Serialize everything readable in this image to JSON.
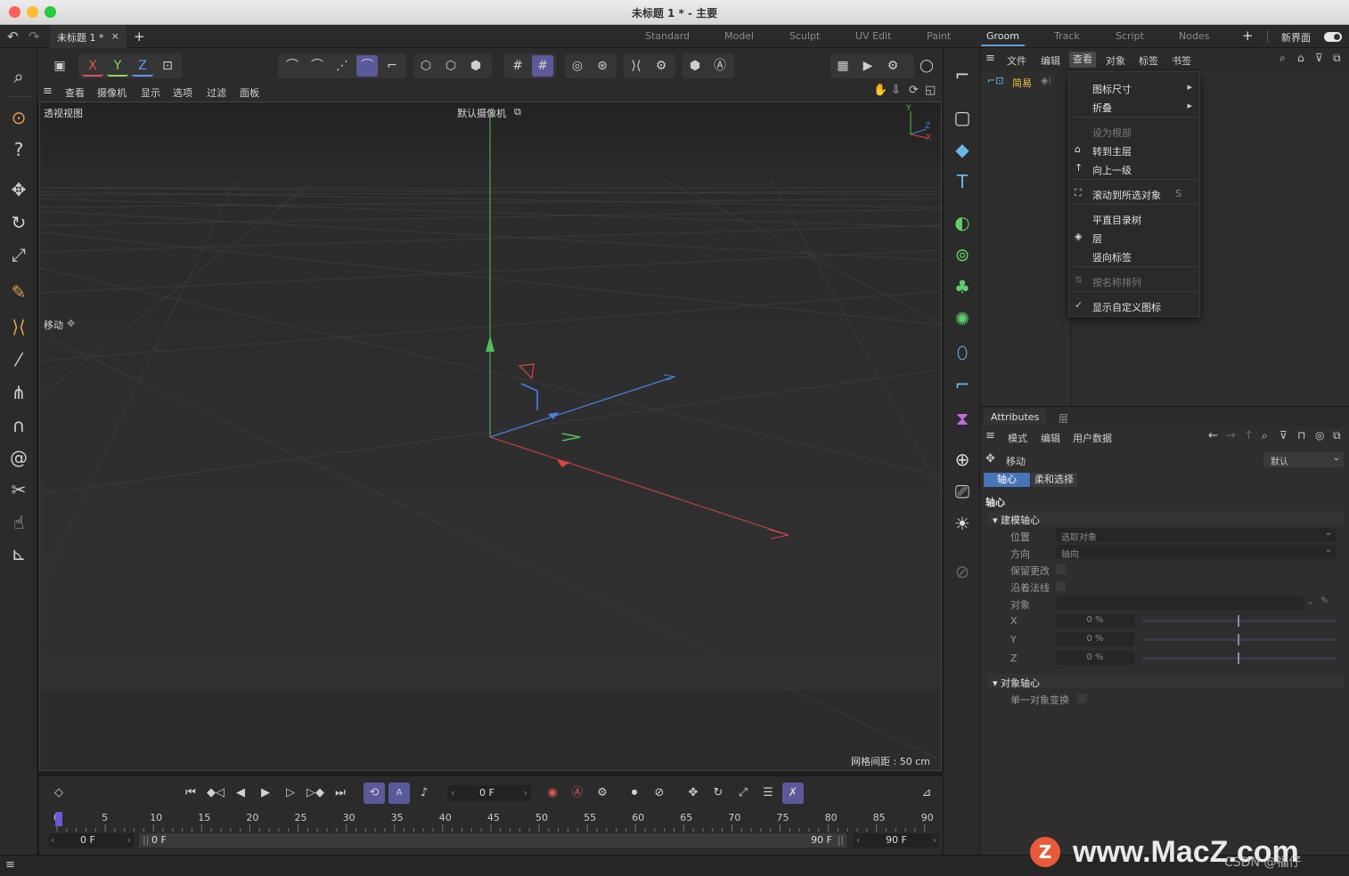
{
  "window": {
    "title": "未标题 1 * - 主要",
    "doc_tab": "未标题 1 *",
    "new_tab": "+"
  },
  "layouts": [
    {
      "label": "Standard",
      "active": false
    },
    {
      "label": "Model",
      "active": false
    },
    {
      "label": "Sculpt",
      "active": false
    },
    {
      "label": "UV Edit",
      "active": false
    },
    {
      "label": "Paint",
      "active": false
    },
    {
      "label": "Groom",
      "active": true
    },
    {
      "label": "Track",
      "active": false
    },
    {
      "label": "Script",
      "active": false
    },
    {
      "label": "Nodes",
      "active": false
    }
  ],
  "layout_plus": "+",
  "new_ui_label": "新界面",
  "axis_lock": {
    "x": "X",
    "y": "Y",
    "z": "Z"
  },
  "viewport_menu": [
    "查看",
    "摄像机",
    "显示",
    "选项",
    "过滤",
    "面板"
  ],
  "viewport": {
    "name": "透视视图",
    "camera": "默认摄像机",
    "tool_label": "移动",
    "grid_spacing": "网格间距 : 50 cm",
    "gizmo_y": "Y",
    "gizmo_z": "Z",
    "gizmo_x": "X"
  },
  "object_manager": {
    "menu": [
      "文件",
      "编辑",
      "查看",
      "对象",
      "标签",
      "书签"
    ],
    "selected_menu_index": 2,
    "mode_label": "简易"
  },
  "view_dropdown": {
    "items": [
      {
        "label": "图标尺寸",
        "submenu": true,
        "disabled": false
      },
      {
        "label": "折叠",
        "submenu": true,
        "disabled": false
      },
      {
        "label": "设为根部",
        "disabled": true
      },
      {
        "label": "转到主层",
        "disabled": false
      },
      {
        "label": "向上一级",
        "disabled": false
      },
      {
        "label": "滚动到所选对象",
        "shortcut": "S",
        "disabled": false
      },
      {
        "label": "平直目录树",
        "disabled": false
      },
      {
        "label": "层",
        "disabled": false
      },
      {
        "label": "竖向标签",
        "disabled": false
      },
      {
        "label": "按名称排列",
        "disabled": true
      },
      {
        "label": "显示自定义图标",
        "checked": true,
        "disabled": false
      }
    ]
  },
  "attributes": {
    "tabs": [
      "Attributes",
      "层"
    ],
    "menu": [
      "模式",
      "编辑",
      "用户数据"
    ],
    "tool": "移动",
    "preset": "默认",
    "subtabs": [
      "轴心",
      "柔和选择"
    ],
    "section": "轴心",
    "group1": "建模轴心",
    "position_label": "位置",
    "position_value": "选取对象",
    "direction_label": "方向",
    "direction_value": "轴向",
    "keep_changes": "保留更改",
    "along_normals": "沿着法线",
    "object_label": "对象",
    "x_label": "X",
    "x_value": "0 %",
    "y_label": "Y",
    "y_value": "0 %",
    "z_label": "Z",
    "z_value": "0 %",
    "group2": "对象轴心",
    "single_transform": "单一对象变换"
  },
  "timeline": {
    "current_frame": "0 F",
    "ticks": [
      "0",
      "5",
      "10",
      "15",
      "20",
      "25",
      "30",
      "35",
      "40",
      "45",
      "50",
      "55",
      "60",
      "65",
      "70",
      "75",
      "80",
      "85",
      "90"
    ],
    "range_start": "0 F",
    "range_start2": "0 F",
    "range_end": "90 F",
    "range_end2": "90 F"
  },
  "watermark": {
    "logo": "Z",
    "text": "www.MacZ.com",
    "sub": "CSDN @福仔"
  }
}
